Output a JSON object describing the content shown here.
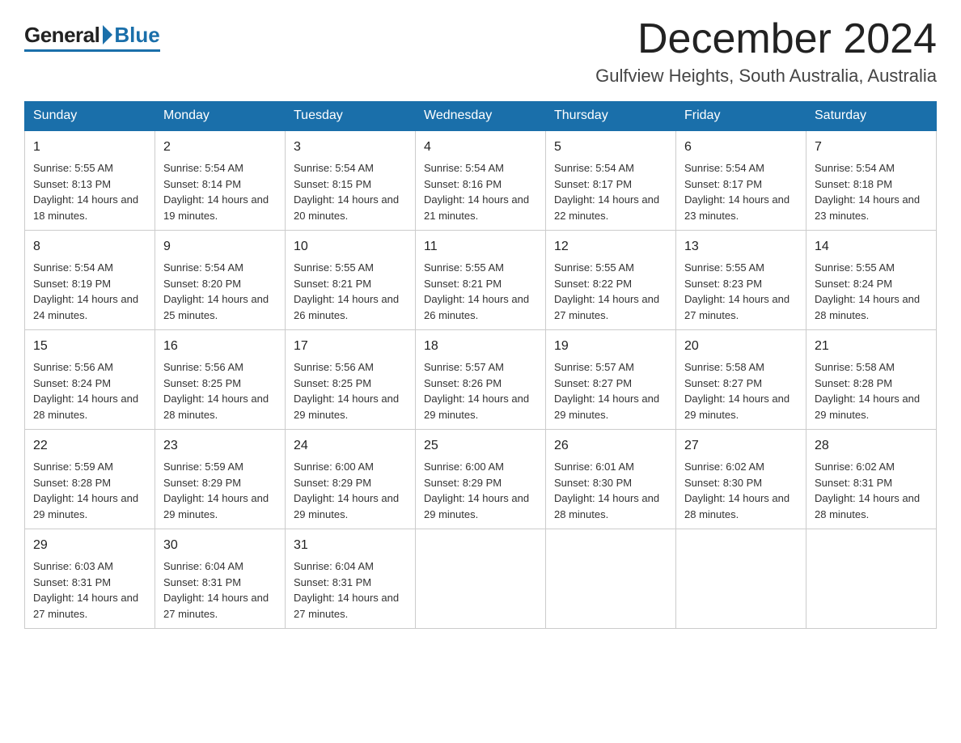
{
  "header": {
    "logo_general": "General",
    "logo_blue": "Blue",
    "month_title": "December 2024",
    "location": "Gulfview Heights, South Australia, Australia"
  },
  "days_of_week": [
    "Sunday",
    "Monday",
    "Tuesday",
    "Wednesday",
    "Thursday",
    "Friday",
    "Saturday"
  ],
  "weeks": [
    [
      {
        "day": "1",
        "sunrise": "5:55 AM",
        "sunset": "8:13 PM",
        "daylight": "14 hours and 18 minutes."
      },
      {
        "day": "2",
        "sunrise": "5:54 AM",
        "sunset": "8:14 PM",
        "daylight": "14 hours and 19 minutes."
      },
      {
        "day": "3",
        "sunrise": "5:54 AM",
        "sunset": "8:15 PM",
        "daylight": "14 hours and 20 minutes."
      },
      {
        "day": "4",
        "sunrise": "5:54 AM",
        "sunset": "8:16 PM",
        "daylight": "14 hours and 21 minutes."
      },
      {
        "day": "5",
        "sunrise": "5:54 AM",
        "sunset": "8:17 PM",
        "daylight": "14 hours and 22 minutes."
      },
      {
        "day": "6",
        "sunrise": "5:54 AM",
        "sunset": "8:17 PM",
        "daylight": "14 hours and 23 minutes."
      },
      {
        "day": "7",
        "sunrise": "5:54 AM",
        "sunset": "8:18 PM",
        "daylight": "14 hours and 23 minutes."
      }
    ],
    [
      {
        "day": "8",
        "sunrise": "5:54 AM",
        "sunset": "8:19 PM",
        "daylight": "14 hours and 24 minutes."
      },
      {
        "day": "9",
        "sunrise": "5:54 AM",
        "sunset": "8:20 PM",
        "daylight": "14 hours and 25 minutes."
      },
      {
        "day": "10",
        "sunrise": "5:55 AM",
        "sunset": "8:21 PM",
        "daylight": "14 hours and 26 minutes."
      },
      {
        "day": "11",
        "sunrise": "5:55 AM",
        "sunset": "8:21 PM",
        "daylight": "14 hours and 26 minutes."
      },
      {
        "day": "12",
        "sunrise": "5:55 AM",
        "sunset": "8:22 PM",
        "daylight": "14 hours and 27 minutes."
      },
      {
        "day": "13",
        "sunrise": "5:55 AM",
        "sunset": "8:23 PM",
        "daylight": "14 hours and 27 minutes."
      },
      {
        "day": "14",
        "sunrise": "5:55 AM",
        "sunset": "8:24 PM",
        "daylight": "14 hours and 28 minutes."
      }
    ],
    [
      {
        "day": "15",
        "sunrise": "5:56 AM",
        "sunset": "8:24 PM",
        "daylight": "14 hours and 28 minutes."
      },
      {
        "day": "16",
        "sunrise": "5:56 AM",
        "sunset": "8:25 PM",
        "daylight": "14 hours and 28 minutes."
      },
      {
        "day": "17",
        "sunrise": "5:56 AM",
        "sunset": "8:25 PM",
        "daylight": "14 hours and 29 minutes."
      },
      {
        "day": "18",
        "sunrise": "5:57 AM",
        "sunset": "8:26 PM",
        "daylight": "14 hours and 29 minutes."
      },
      {
        "day": "19",
        "sunrise": "5:57 AM",
        "sunset": "8:27 PM",
        "daylight": "14 hours and 29 minutes."
      },
      {
        "day": "20",
        "sunrise": "5:58 AM",
        "sunset": "8:27 PM",
        "daylight": "14 hours and 29 minutes."
      },
      {
        "day": "21",
        "sunrise": "5:58 AM",
        "sunset": "8:28 PM",
        "daylight": "14 hours and 29 minutes."
      }
    ],
    [
      {
        "day": "22",
        "sunrise": "5:59 AM",
        "sunset": "8:28 PM",
        "daylight": "14 hours and 29 minutes."
      },
      {
        "day": "23",
        "sunrise": "5:59 AM",
        "sunset": "8:29 PM",
        "daylight": "14 hours and 29 minutes."
      },
      {
        "day": "24",
        "sunrise": "6:00 AM",
        "sunset": "8:29 PM",
        "daylight": "14 hours and 29 minutes."
      },
      {
        "day": "25",
        "sunrise": "6:00 AM",
        "sunset": "8:29 PM",
        "daylight": "14 hours and 29 minutes."
      },
      {
        "day": "26",
        "sunrise": "6:01 AM",
        "sunset": "8:30 PM",
        "daylight": "14 hours and 28 minutes."
      },
      {
        "day": "27",
        "sunrise": "6:02 AM",
        "sunset": "8:30 PM",
        "daylight": "14 hours and 28 minutes."
      },
      {
        "day": "28",
        "sunrise": "6:02 AM",
        "sunset": "8:31 PM",
        "daylight": "14 hours and 28 minutes."
      }
    ],
    [
      {
        "day": "29",
        "sunrise": "6:03 AM",
        "sunset": "8:31 PM",
        "daylight": "14 hours and 27 minutes."
      },
      {
        "day": "30",
        "sunrise": "6:04 AM",
        "sunset": "8:31 PM",
        "daylight": "14 hours and 27 minutes."
      },
      {
        "day": "31",
        "sunrise": "6:04 AM",
        "sunset": "8:31 PM",
        "daylight": "14 hours and 27 minutes."
      },
      null,
      null,
      null,
      null
    ]
  ],
  "labels": {
    "sunrise_prefix": "Sunrise: ",
    "sunset_prefix": "Sunset: ",
    "daylight_prefix": "Daylight: "
  }
}
